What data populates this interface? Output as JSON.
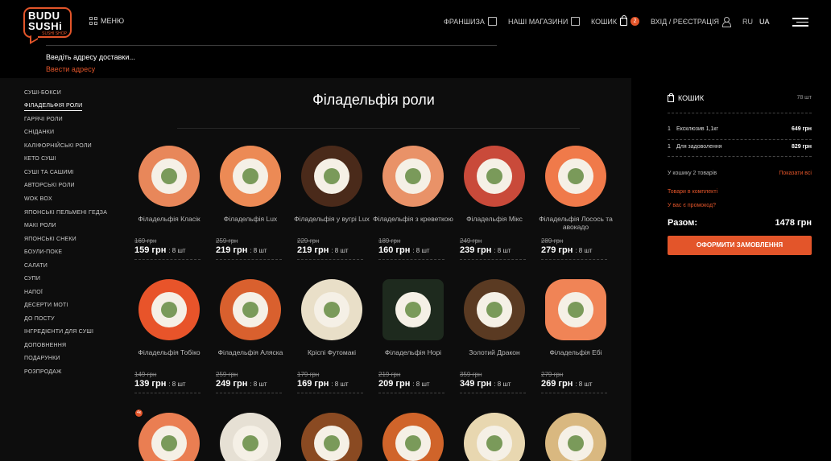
{
  "brand": {
    "line1": "BUDU",
    "line2": "SUSHi",
    "line3": "SUSHI SHOP",
    "accent": "#e3552a"
  },
  "header": {
    "menu_label": "МЕНЮ",
    "franchise": "ФРАНШИЗА",
    "stores": "НАШІ МАГАЗИНИ",
    "cart": "КОШИК",
    "cart_badge": "2",
    "login": "ВХІД / РЕЄСТРАЦІЯ",
    "lang_ru": "RU",
    "lang_ua": "UA"
  },
  "address": {
    "label": "Введіть адресу доставки...",
    "link": "Ввести адресу"
  },
  "sidebar": {
    "items": [
      "Суші-бокси",
      "Філадельфія роли",
      "Гарячі роли",
      "Сніданки",
      "Каліфорнійські роли",
      "Кето суші",
      "Суші та сашимі",
      "Авторські роли",
      "Wok box",
      "Японські пельмені гедза",
      "Макі роли",
      "Японські снеки",
      "Боули-поке",
      "Салати",
      "Супи",
      "Напої",
      "Десерти моті",
      "До посту",
      "Інгредієнти для суші",
      "Доповнення",
      "Подарунки",
      "Розпродаж"
    ],
    "active_index": 1
  },
  "main": {
    "title": "Філадельфія роли",
    "products": [
      {
        "name": "Філадельфія Класік",
        "old": "169 грн",
        "price": "159 грн",
        "qty": ": 8 шт"
      },
      {
        "name": "Філадельфія Lux",
        "old": "259 грн",
        "price": "219 грн",
        "qty": ": 8 шт"
      },
      {
        "name": "Філадельфія у вугрі Lux",
        "old": "229 грн",
        "price": "219 грн",
        "qty": ": 8 шт"
      },
      {
        "name": "Філадельфія з креветкою",
        "old": "189 грн",
        "price": "160 грн",
        "qty": ": 8 шт"
      },
      {
        "name": "Філадельфія Мікс",
        "old": "249 грн",
        "price": "239 грн",
        "qty": ": 8 шт"
      },
      {
        "name": "Філадельфія Лосось та авокадо",
        "old": "289 грн",
        "price": "279 грн",
        "qty": ": 8 шт"
      },
      {
        "name": "Філадельфія Тобіко",
        "old": "149 грн",
        "price": "139 грн",
        "qty": ": 8 шт"
      },
      {
        "name": "Філадельфія Аляска",
        "old": "259 грн",
        "price": "249 грн",
        "qty": ": 8 шт"
      },
      {
        "name": "Кріспі Футомакі",
        "old": "179 грн",
        "price": "169 грн",
        "qty": ": 8 шт"
      },
      {
        "name": "Філадельфія Норі",
        "old": "219 грн",
        "price": "209 грн",
        "qty": ": 8 шт"
      },
      {
        "name": "Золотий Дракон",
        "old": "359 грн",
        "price": "349 грн",
        "qty": ": 8 шт"
      },
      {
        "name": "Філадельфія Ебі",
        "old": "279 грн",
        "price": "269 грн",
        "qty": ": 8 шт"
      }
    ],
    "hot_badge": "4к"
  },
  "cart": {
    "title": "КОШИК",
    "count": "78 шт",
    "items": [
      {
        "qty": "1",
        "name": "Ексклюзив 1,1кг",
        "price": "649 грн"
      },
      {
        "qty": "1",
        "name": "Для задоволення",
        "price": "829 грн"
      }
    ],
    "info": "У кошику 2 товарів",
    "show_all": "Показати всі",
    "complect": "Товари в комплекті",
    "promo": "У вас є промокод?",
    "total_label": "Разом:",
    "total_value": "1478 грн",
    "order_button": "Оформити замовлення"
  }
}
